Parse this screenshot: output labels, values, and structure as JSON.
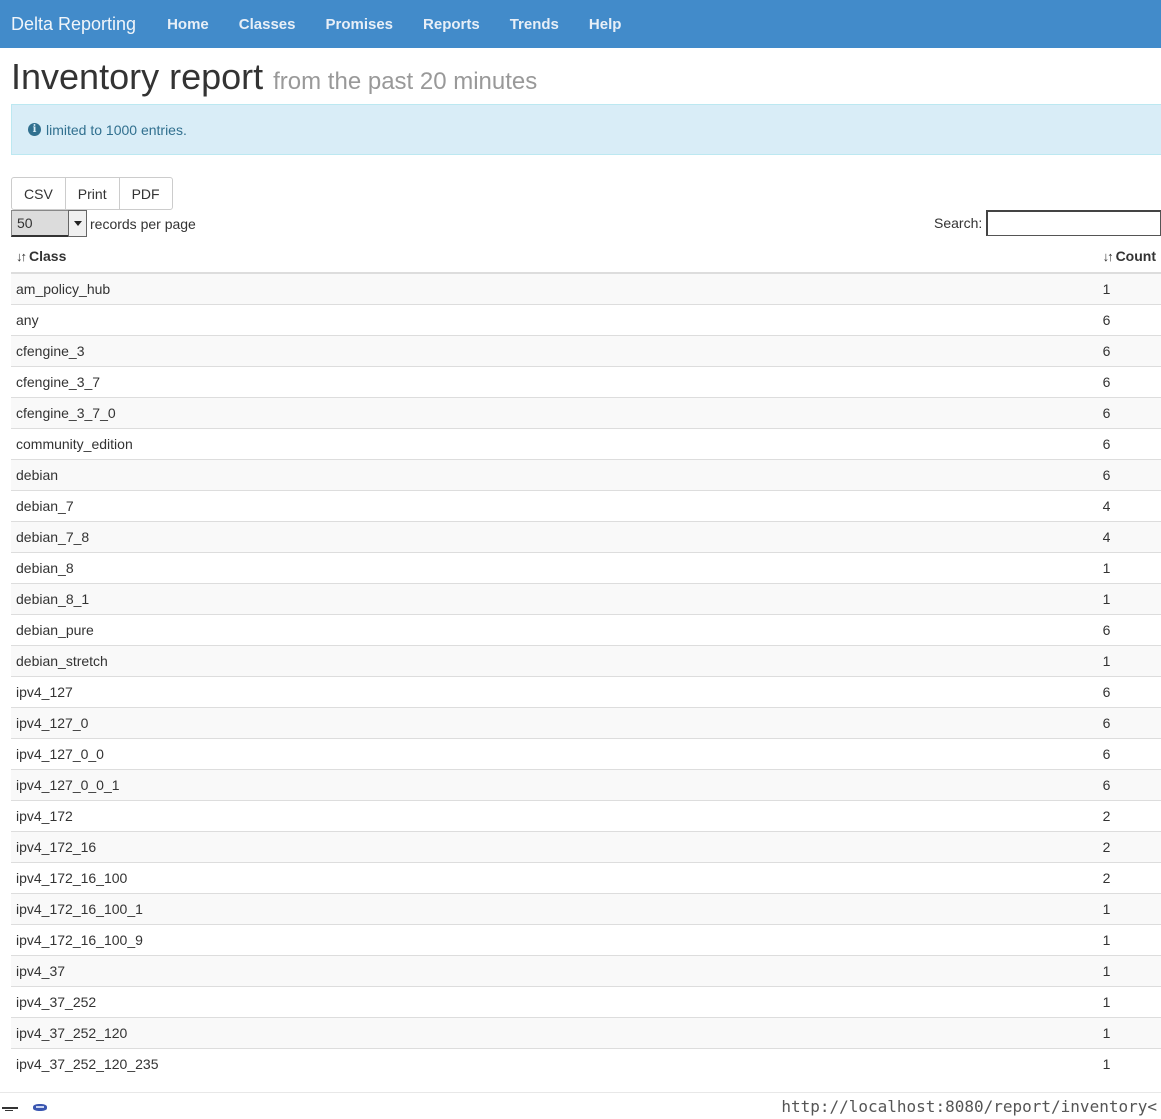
{
  "nav": {
    "brand": "Delta Reporting",
    "items": [
      "Home",
      "Classes",
      "Promises",
      "Reports",
      "Trends",
      "Help"
    ]
  },
  "header": {
    "title": "Inventory report",
    "subtitle": "from the past 20 minutes"
  },
  "alert": {
    "icon": "info-circle-icon",
    "text": "limited to 1000 entries."
  },
  "export_buttons": [
    "CSV",
    "Print",
    "PDF"
  ],
  "length_menu": {
    "selected": "50",
    "label": "records per page"
  },
  "search": {
    "label": "Search:",
    "value": ""
  },
  "table": {
    "columns": [
      "Class",
      "Count"
    ],
    "rows": [
      [
        "am_policy_hub",
        "1"
      ],
      [
        "any",
        "6"
      ],
      [
        "cfengine_3",
        "6"
      ],
      [
        "cfengine_3_7",
        "6"
      ],
      [
        "cfengine_3_7_0",
        "6"
      ],
      [
        "community_edition",
        "6"
      ],
      [
        "debian",
        "6"
      ],
      [
        "debian_7",
        "4"
      ],
      [
        "debian_7_8",
        "4"
      ],
      [
        "debian_8",
        "1"
      ],
      [
        "debian_8_1",
        "1"
      ],
      [
        "debian_pure",
        "6"
      ],
      [
        "debian_stretch",
        "1"
      ],
      [
        "ipv4_127",
        "6"
      ],
      [
        "ipv4_127_0",
        "6"
      ],
      [
        "ipv4_127_0_0",
        "6"
      ],
      [
        "ipv4_127_0_0_1",
        "6"
      ],
      [
        "ipv4_172",
        "2"
      ],
      [
        "ipv4_172_16",
        "2"
      ],
      [
        "ipv4_172_16_100",
        "2"
      ],
      [
        "ipv4_172_16_100_1",
        "1"
      ],
      [
        "ipv4_172_16_100_9",
        "1"
      ],
      [
        "ipv4_37",
        "1"
      ],
      [
        "ipv4_37_252",
        "1"
      ],
      [
        "ipv4_37_252_120",
        "1"
      ],
      [
        "ipv4_37_252_120_235",
        "1"
      ]
    ]
  },
  "statusbar": {
    "url": "http://localhost:8080/report/inventory<"
  },
  "colors": {
    "navbar": "#428bca",
    "alert_bg": "#d9edf7",
    "alert_text": "#31708f"
  }
}
